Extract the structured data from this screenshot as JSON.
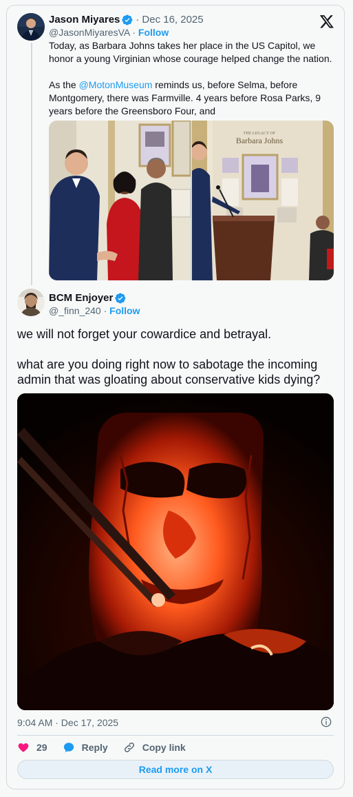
{
  "quoted_tweet": {
    "author_name": "Jason Miyares",
    "date": "Dec 16, 2025",
    "handle": "@JasonMiyaresVA",
    "follow_label": "Follow",
    "text_line1": "Today, as Barbara Johns takes her place in the US Capitol, we honor a young Virginian whose courage helped change the nation.",
    "text2_mention": "@MotonMuseum",
    "text2_rest": " reminds us, before Selma, before Montgomery, there was Farmville. 4 years before Rosa Parks, 9 years before the Greensboro Four, and",
    "text2_prefix": "As the ",
    "exhibit_caption_small": "THE LEGACY OF",
    "exhibit_caption_large": "Barbara Johns"
  },
  "reply_tweet": {
    "author_name": "BCM Enjoyer",
    "handle": "@_finn_240",
    "follow_label": "Follow",
    "text_para1": "we will not forget your cowardice and betrayal.",
    "text_para2": "what are you doing right now to sabotage the incoming admin that was gloating about conservative kids dying?",
    "timestamp": "9:04 AM · Dec 17, 2025",
    "likes": "29",
    "reply_label": "Reply",
    "copy_label": "Copy link",
    "read_more_label": "Read more on X"
  },
  "colors": {
    "accent": "#1d9bf0",
    "like": "#f91880",
    "text_secondary": "#536471"
  }
}
